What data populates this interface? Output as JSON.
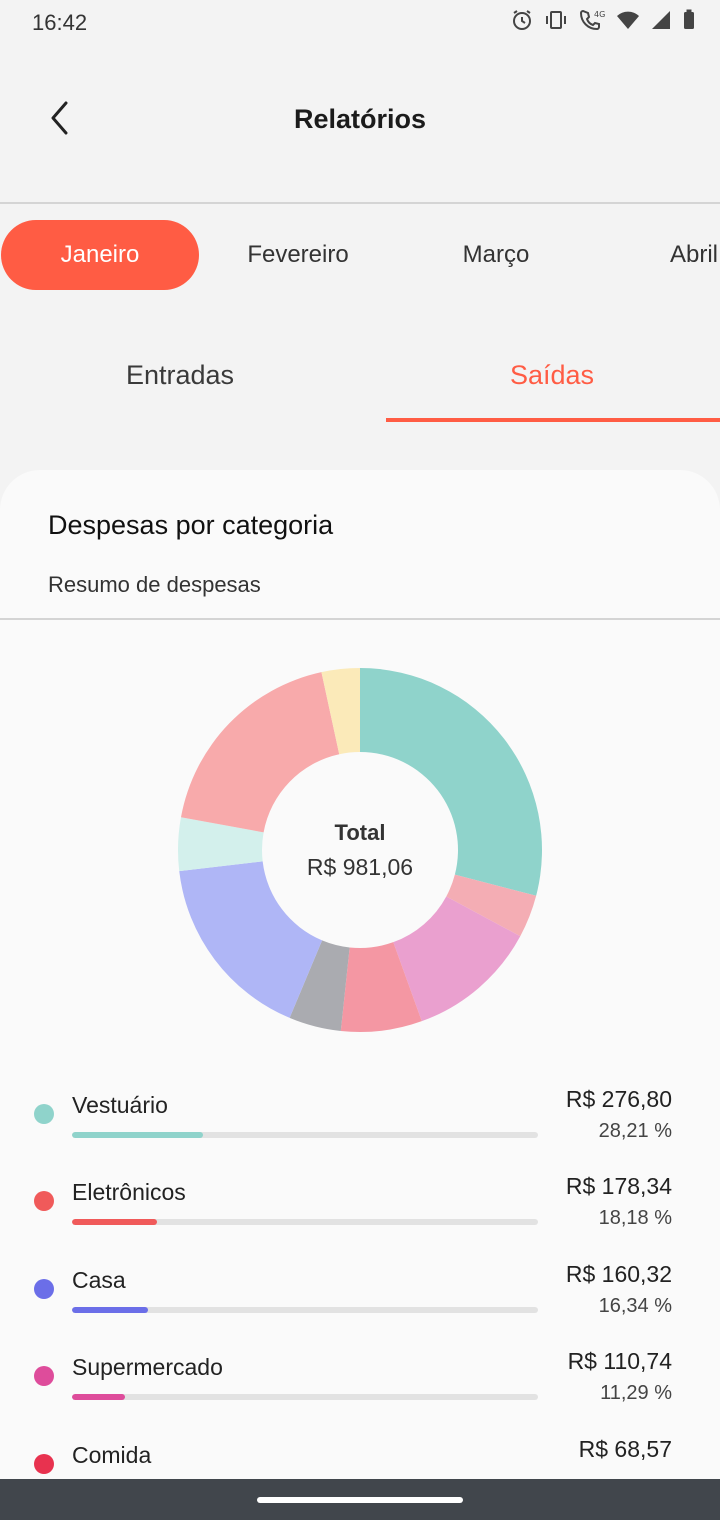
{
  "status_bar": {
    "time": "16:42",
    "icons": [
      "alarm-icon",
      "vibrate-icon",
      "wifi-call-icon",
      "wifi-icon",
      "signal-icon",
      "battery-icon"
    ],
    "network_label": "4G"
  },
  "header": {
    "title": "Relatórios",
    "back_icon": "chevron-left-icon"
  },
  "months": {
    "items": [
      "Janeiro",
      "Fevereiro",
      "Março",
      "Abril"
    ],
    "selected": "Janeiro"
  },
  "tabs": {
    "items": [
      "Entradas",
      "Saídas"
    ],
    "selected": "Saídas"
  },
  "card": {
    "title": "Despesas por categoria",
    "subtitle": "Resumo de despesas",
    "total_label": "Total",
    "total_value": "R$ 981,06"
  },
  "chart_data": {
    "type": "pie",
    "style": "donut",
    "total": 981.06,
    "slices": [
      {
        "color": "#8fd3cb",
        "percent": 28.21
      },
      {
        "color": "#f4adb4",
        "percent": 3.7
      },
      {
        "color": "#eaa0cf",
        "percent": 11.29
      },
      {
        "color": "#f497a3",
        "percent": 6.99
      },
      {
        "color": "#aaabb0",
        "percent": 4.5
      },
      {
        "color": "#afb6f6",
        "percent": 16.34
      },
      {
        "color": "#d3f0ec",
        "percent": 4.6
      },
      {
        "color": "#f8aaab",
        "percent": 18.18
      },
      {
        "color": "#fbeab9",
        "percent": 3.3
      }
    ]
  },
  "categories": [
    {
      "name": "Vestuário",
      "amount": "R$ 276,80",
      "percent_label": "28,21 %",
      "percent": 28.21,
      "color": "#8fd3cb"
    },
    {
      "name": "Eletrônicos",
      "amount": "R$ 178,34",
      "percent_label": "18,18 %",
      "percent": 18.18,
      "color": "#f05a5a"
    },
    {
      "name": "Casa",
      "amount": "R$ 160,32",
      "percent_label": "16,34 %",
      "percent": 16.34,
      "color": "#6b6ee8"
    },
    {
      "name": "Supermercado",
      "amount": "R$ 110,74",
      "percent_label": "11,29 %",
      "percent": 11.29,
      "color": "#de4c9b"
    },
    {
      "name": "Comida",
      "amount": "R$ 68,57",
      "percent_label": "",
      "percent": 6.99,
      "color": "#e8324f"
    }
  ],
  "colors": {
    "accent": "#ff5c44",
    "nav_bar": "#41464c"
  }
}
